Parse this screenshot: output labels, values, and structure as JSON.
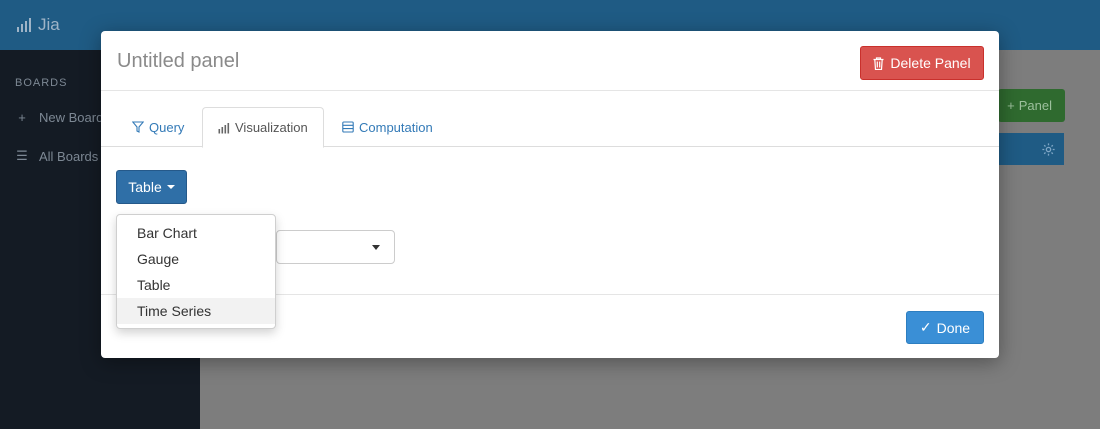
{
  "app": {
    "brand": "Jia",
    "brand_icon": "bar-chart-icon"
  },
  "sidebar": {
    "heading": "BOARDS",
    "items": [
      {
        "label": "New Board",
        "icon": "plus-icon"
      },
      {
        "label": "All Boards",
        "icon": "list-icon"
      }
    ]
  },
  "content": {
    "add_panel_label": "Panel",
    "settings_icon": "gear-icon"
  },
  "modal": {
    "title": "Untitled panel",
    "delete_label": "Delete Panel",
    "tabs": [
      {
        "label": "Query",
        "icon": "filter-icon",
        "active": false
      },
      {
        "label": "Visualization",
        "icon": "bar-chart-icon",
        "active": true
      },
      {
        "label": "Computation",
        "icon": "database-icon",
        "active": false
      }
    ],
    "visualization": {
      "selected": "Table",
      "options": [
        "Bar Chart",
        "Gauge",
        "Table",
        "Time Series"
      ],
      "hovered": "Time Series"
    },
    "done_label": "Done"
  },
  "colors": {
    "topbar": "#1f5b84",
    "sidebar": "#141b24",
    "danger": "#d9534f",
    "primary": "#2f6fa7",
    "done": "#3a8fd6",
    "success": "#2f6a2f"
  }
}
